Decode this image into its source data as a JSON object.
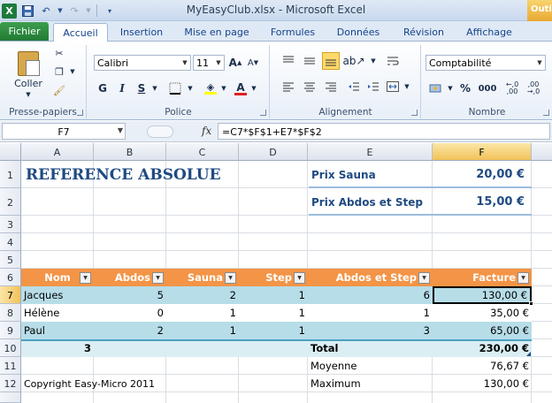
{
  "window": {
    "title": "MyEasyClub.xlsx  -  Microsoft Excel",
    "context_tab": "Outil"
  },
  "tabs": [
    "Fichier",
    "Accueil",
    "Insertion",
    "Mise en page",
    "Formules",
    "Données",
    "Révision",
    "Affichage"
  ],
  "ribbon": {
    "clipboard": {
      "paste": "Coller",
      "label": "Presse-papiers"
    },
    "font": {
      "name": "Calibri",
      "size": "11",
      "bold": "G",
      "italic": "I",
      "underline": "S",
      "label": "Police"
    },
    "alignment": {
      "label": "Alignement"
    },
    "number": {
      "format": "Comptabilité",
      "label": "Nombre",
      "percent": "%",
      "thousands": "000"
    }
  },
  "formula_bar": {
    "cell": "F7",
    "fx": "fx",
    "formula": "=C7*$F$1+E7*$F$2"
  },
  "columns": [
    "A",
    "B",
    "C",
    "D",
    "E",
    "F"
  ],
  "rows": [
    "1",
    "2",
    "3",
    "4",
    "5",
    "6",
    "7",
    "8",
    "9",
    "10",
    "11",
    "12"
  ],
  "sheet": {
    "title": "REFERENCE ABSOLUE",
    "prix_sauna_label": "Prix Sauna",
    "prix_sauna_value": "20,00 €",
    "prix_abdos_label": "Prix Abdos et Step",
    "prix_abdos_value": "15,00 €",
    "headers": [
      "Nom",
      "Abdos",
      "Sauna",
      "Step",
      "Abdos et Step",
      "Facture"
    ],
    "data": [
      {
        "nom": "Jacques",
        "abdos": "5",
        "sauna": "2",
        "step": "1",
        "abdos_step": "6",
        "facture": "130,00 €"
      },
      {
        "nom": "Hélène",
        "abdos": "0",
        "sauna": "1",
        "step": "1",
        "abdos_step": "1",
        "facture": "35,00 €"
      },
      {
        "nom": "Paul",
        "abdos": "2",
        "sauna": "1",
        "step": "1",
        "abdos_step": "3",
        "facture": "65,00 €"
      }
    ],
    "count": "3",
    "total_label": "Total",
    "total_value": "230,00 €",
    "moyenne_label": "Moyenne",
    "moyenne_value": "76,67 €",
    "maximum_label": "Maximum",
    "maximum_value": "130,00 €",
    "copyright": "Copyright Easy-Micro 2011"
  },
  "colors": {
    "header_orange": "#f39446",
    "row_blue": "#b7dde8",
    "row_light": "#daeef3",
    "title_blue": "#1f4a82"
  }
}
